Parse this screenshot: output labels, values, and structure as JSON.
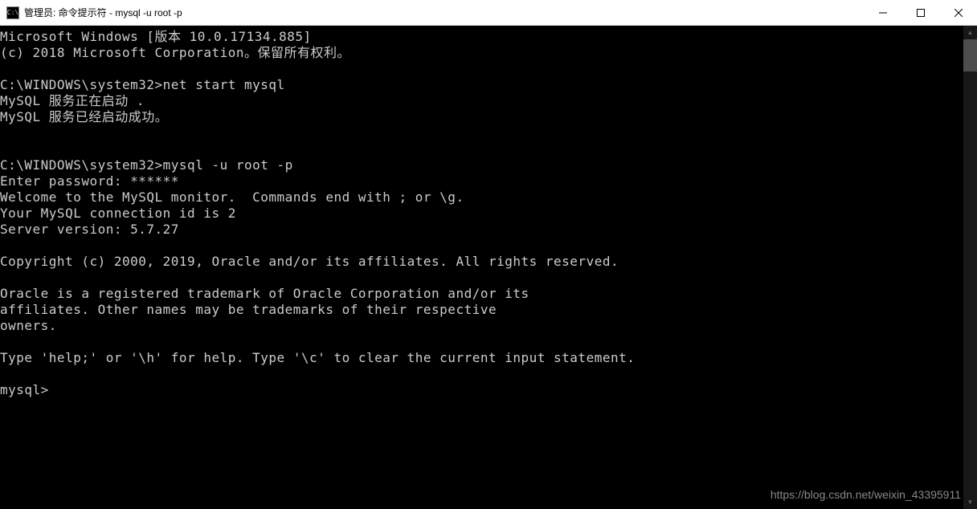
{
  "titlebar": {
    "icon_text": "C:\\",
    "title": "管理员: 命令提示符 - mysql  -u root -p"
  },
  "terminal": {
    "lines": [
      "Microsoft Windows [版本 10.0.17134.885]",
      "(c) 2018 Microsoft Corporation。保留所有权利。",
      "",
      "C:\\WINDOWS\\system32>net start mysql",
      "MySQL 服务正在启动 .",
      "MySQL 服务已经启动成功。",
      "",
      "",
      "C:\\WINDOWS\\system32>mysql -u root -p",
      "Enter password: ******",
      "Welcome to the MySQL monitor.  Commands end with ; or \\g.",
      "Your MySQL connection id is 2",
      "Server version: 5.7.27",
      "",
      "Copyright (c) 2000, 2019, Oracle and/or its affiliates. All rights reserved.",
      "",
      "Oracle is a registered trademark of Oracle Corporation and/or its",
      "affiliates. Other names may be trademarks of their respective",
      "owners.",
      "",
      "Type 'help;' or '\\h' for help. Type '\\c' to clear the current input statement.",
      "",
      "mysql>"
    ]
  },
  "watermark": "https://blog.csdn.net/weixin_43395911"
}
